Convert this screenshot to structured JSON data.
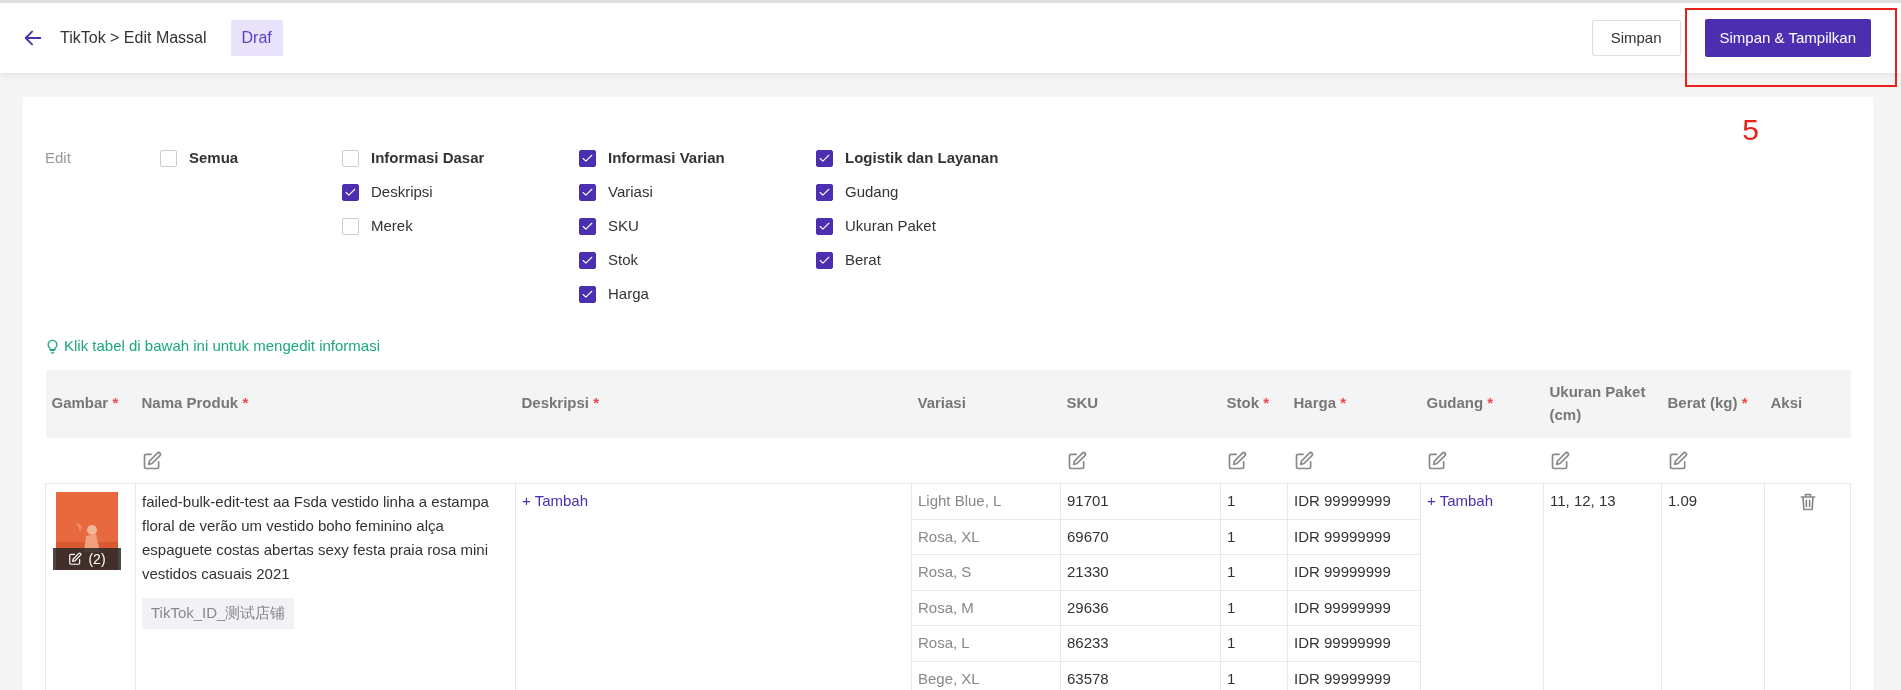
{
  "header": {
    "breadcrumb": "TikTok > Edit Massal",
    "status_badge": "Draf",
    "buttons": [
      {
        "label": "Simpan",
        "kind": "secondary"
      },
      {
        "label": "Simpan & Tampilkan",
        "kind": "primary"
      }
    ],
    "annotation": "5"
  },
  "edit_options": {
    "label": "Edit",
    "groups": [
      {
        "label": "Semua",
        "checked": false
      },
      {
        "label": "Informasi Dasar",
        "checked": false,
        "children": [
          {
            "label": "Deskripsi",
            "checked": true
          },
          {
            "label": "Merek",
            "checked": false
          }
        ]
      },
      {
        "label": "Informasi Varian",
        "checked": true,
        "children": [
          {
            "label": "Variasi",
            "checked": true
          },
          {
            "label": "SKU",
            "checked": true
          },
          {
            "label": "Stok",
            "checked": true
          },
          {
            "label": "Harga",
            "checked": true
          }
        ]
      },
      {
        "label": "Logistik dan Layanan",
        "checked": true,
        "children": [
          {
            "label": "Gudang",
            "checked": true
          },
          {
            "label": "Ukuran Paket",
            "checked": true
          },
          {
            "label": "Berat",
            "checked": true
          }
        ]
      }
    ]
  },
  "hint": "Klik tabel di bawah ini untuk mengedit informasi",
  "table": {
    "columns": [
      {
        "label": "Gambar",
        "required_mark": "*",
        "editable": false
      },
      {
        "label": "Nama Produk",
        "required_mark": "*",
        "editable": true
      },
      {
        "label": "Deskripsi",
        "required_mark": "*",
        "editable": false
      },
      {
        "label": "Variasi",
        "editable": false
      },
      {
        "label": "SKU",
        "editable": true
      },
      {
        "label": "Stok",
        "required_mark": "*",
        "editable": true
      },
      {
        "label": "Harga",
        "required_mark": "*",
        "editable": true
      },
      {
        "label": "Gudang",
        "required_mark": "*",
        "editable": true
      },
      {
        "label": "Ukuran Paket (cm)",
        "editable": true
      },
      {
        "label": "Berat (kg)",
        "required_mark": "*",
        "editable": true
      },
      {
        "label": "Aksi",
        "editable": false
      }
    ],
    "rows": [
      {
        "image_count": "(2)",
        "name": "failed-bulk-edit-test aa Fsda vestido linha a estampa floral de verão um vestido boho feminino alça espaguete costas abertas sexy festa praia rosa mini vestidos casuais 2021",
        "shop_tag": "TikTok_ID_测试店铺",
        "description_action": "+ Tambah",
        "warehouse_action": "+ Tambah",
        "package_size": "11, 12, 13",
        "weight": "1.09",
        "variants": [
          {
            "variation": "Light Blue, L",
            "sku": "91701",
            "stock": "1",
            "price": "IDR 99999999"
          },
          {
            "variation": "Rosa, XL",
            "sku": "69670",
            "stock": "1",
            "price": "IDR 99999999"
          },
          {
            "variation": "Rosa, S",
            "sku": "21330",
            "stock": "1",
            "price": "IDR 99999999"
          },
          {
            "variation": "Rosa, M",
            "sku": "29636",
            "stock": "1",
            "price": "IDR 99999999"
          },
          {
            "variation": "Rosa, L",
            "sku": "86233",
            "stock": "1",
            "price": "IDR 99999999"
          },
          {
            "variation": "Bege, XL",
            "sku": "63578",
            "stock": "1",
            "price": "IDR 99999999"
          }
        ]
      }
    ]
  }
}
